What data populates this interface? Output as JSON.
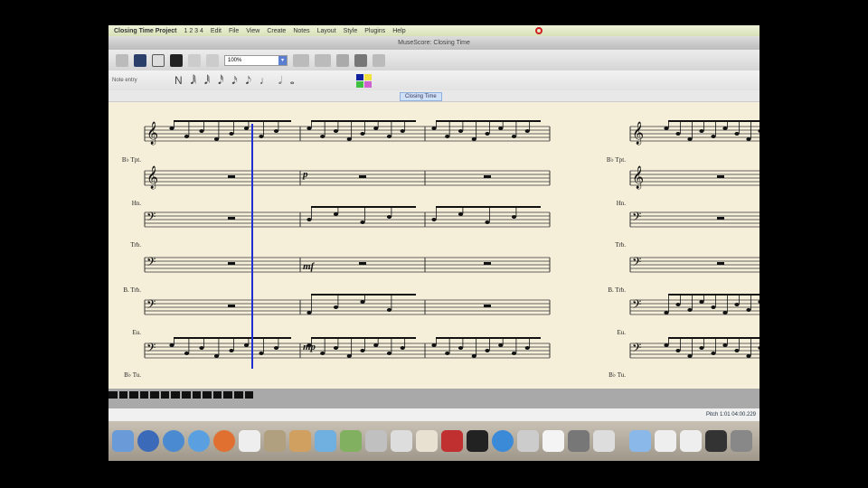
{
  "menubar": {
    "app": "Closing Time Project",
    "items": [
      "1 2 3 4",
      "Edit",
      "File",
      "View",
      "Create",
      "Notes",
      "Layout",
      "Style",
      "Plugins",
      "Help"
    ]
  },
  "window": {
    "title": "MuseScore: Closing Time"
  },
  "toolbar": {
    "zoom": "100%"
  },
  "palette": {
    "label": "Note entry",
    "notes": [
      "N",
      "𝅘𝅥𝅲",
      "𝅘𝅥𝅱",
      "𝅘𝅥𝅰",
      "𝅘𝅥𝅯",
      "𝅘𝅥𝅮",
      "♩",
      "𝅗𝅥",
      "𝅝"
    ],
    "colors": [
      "#1020a0",
      "#f0e040",
      "#40c040",
      "#d060d0"
    ]
  },
  "tabs": [
    {
      "label": "Closing Time"
    }
  ],
  "score": {
    "instruments": [
      "B♭ Tpt.",
      "Hn.",
      "Trb.",
      "B. Trb.",
      "Eu.",
      "B♭ Tu."
    ],
    "dynamics": [
      {
        "staff": 0,
        "text": "p"
      },
      {
        "staff": 2,
        "text": "mf"
      },
      {
        "staff": 4,
        "text": "mp"
      },
      {
        "staff": 5,
        "text": "mf"
      }
    ]
  },
  "statusbar": {
    "text": "Pitch 1:01 04:00.229"
  }
}
